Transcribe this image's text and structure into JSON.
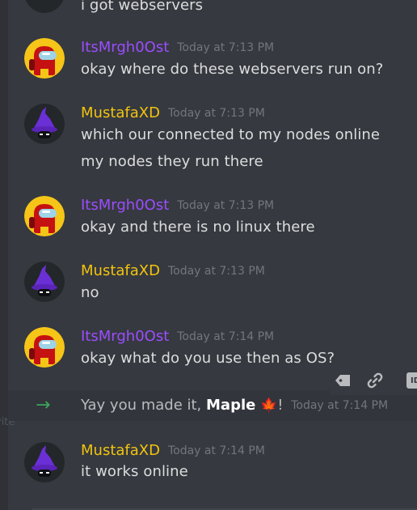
{
  "colors": {
    "background": "#36393f",
    "mrgh_name": "#9b4dff",
    "mustafa_name": "#f1c40f",
    "timestamp": "#72767d",
    "join_arrow": "#3ba55d"
  },
  "left_strip": {
    "ghost_label": "vite"
  },
  "messages": [
    {
      "text": "i got webservers"
    },
    {
      "author": "ItsMrgh0Ost",
      "timestamp": "Today at 7:13 PM",
      "text": "okay where do these webservers run on?"
    },
    {
      "author": "MustafaXD",
      "timestamp": "Today at 7:13 PM",
      "text": "which our connected to my nodes online",
      "text2": "my nodes they run there"
    },
    {
      "author": "ItsMrgh0Ost",
      "timestamp": "Today at 7:13 PM",
      "text": "okay and there is no linux there"
    },
    {
      "author": "MustafaXD",
      "timestamp": "Today at 7:13 PM",
      "text": "no"
    },
    {
      "author": "ItsMrgh0Ost",
      "timestamp": "Today at 7:14 PM",
      "text": "okay what do you use then as OS?"
    },
    {
      "author": "MustafaXD",
      "timestamp": "Today at 7:14 PM",
      "text": "it works online"
    }
  ],
  "system_message": {
    "arrow": "→",
    "prefix": "Yay you made it, ",
    "name": "Maple",
    "emoji": "🍁",
    "suffix": "!",
    "timestamp": "Today at 7:14 PM"
  },
  "toolbar": {
    "icons": [
      "tag-icon",
      "link-icon",
      "id-icon"
    ],
    "id_label": "ID"
  }
}
